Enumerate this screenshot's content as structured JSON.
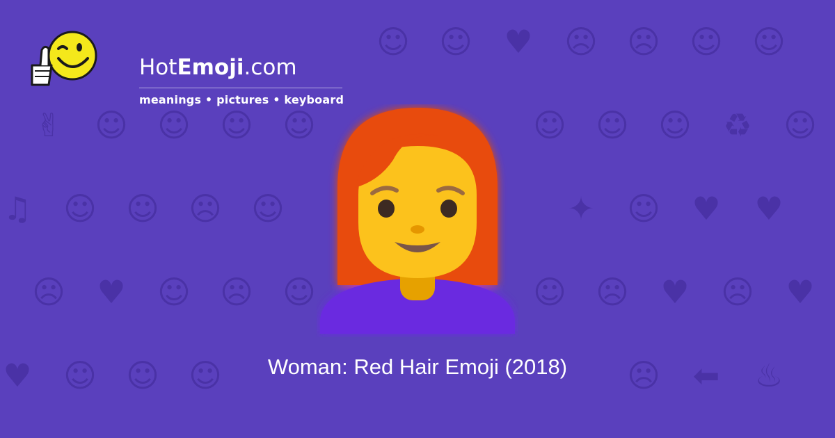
{
  "brand": {
    "name_prefix": "Hot",
    "name_strong": "Emoji",
    "name_suffix": ".com",
    "tagline": "meanings • pictures • keyboard"
  },
  "emoji": {
    "caption": "Woman: Red Hair Emoji (2018)",
    "icon": "woman-red-hair-icon"
  },
  "colors": {
    "background": "#5a40bd",
    "background_glyph": "#4a32a6",
    "hair": "#e84b0e",
    "skin": "#fcc21b",
    "shirt": "#6a2ae0"
  },
  "background_glyphs": [
    "☺",
    "☺",
    "♥",
    "☹",
    "☹",
    "☺",
    "☺",
    "✌",
    "☺",
    "☺",
    "☺",
    "☺",
    "☺",
    "☺",
    "☺",
    "♻",
    "☺",
    "♫",
    "☺",
    "☺",
    "☹",
    "☺",
    "✦",
    "☺",
    "♥",
    "♥",
    "☹",
    "♥",
    "☺",
    "☹",
    "☺",
    "☺",
    "☹",
    "♥",
    "☹",
    "♥",
    "♥",
    "☺",
    "☺",
    "☺",
    "☹",
    "⬅",
    "♨",
    "☺",
    "☺",
    "☺",
    "☺",
    "☺",
    "✿",
    "☀",
    "☺",
    "♥",
    "✔",
    "☺",
    "☻",
    "☺",
    "✋",
    "☺",
    "☺",
    "☹",
    "♥",
    "☺",
    "♥",
    "☺",
    "☺"
  ]
}
